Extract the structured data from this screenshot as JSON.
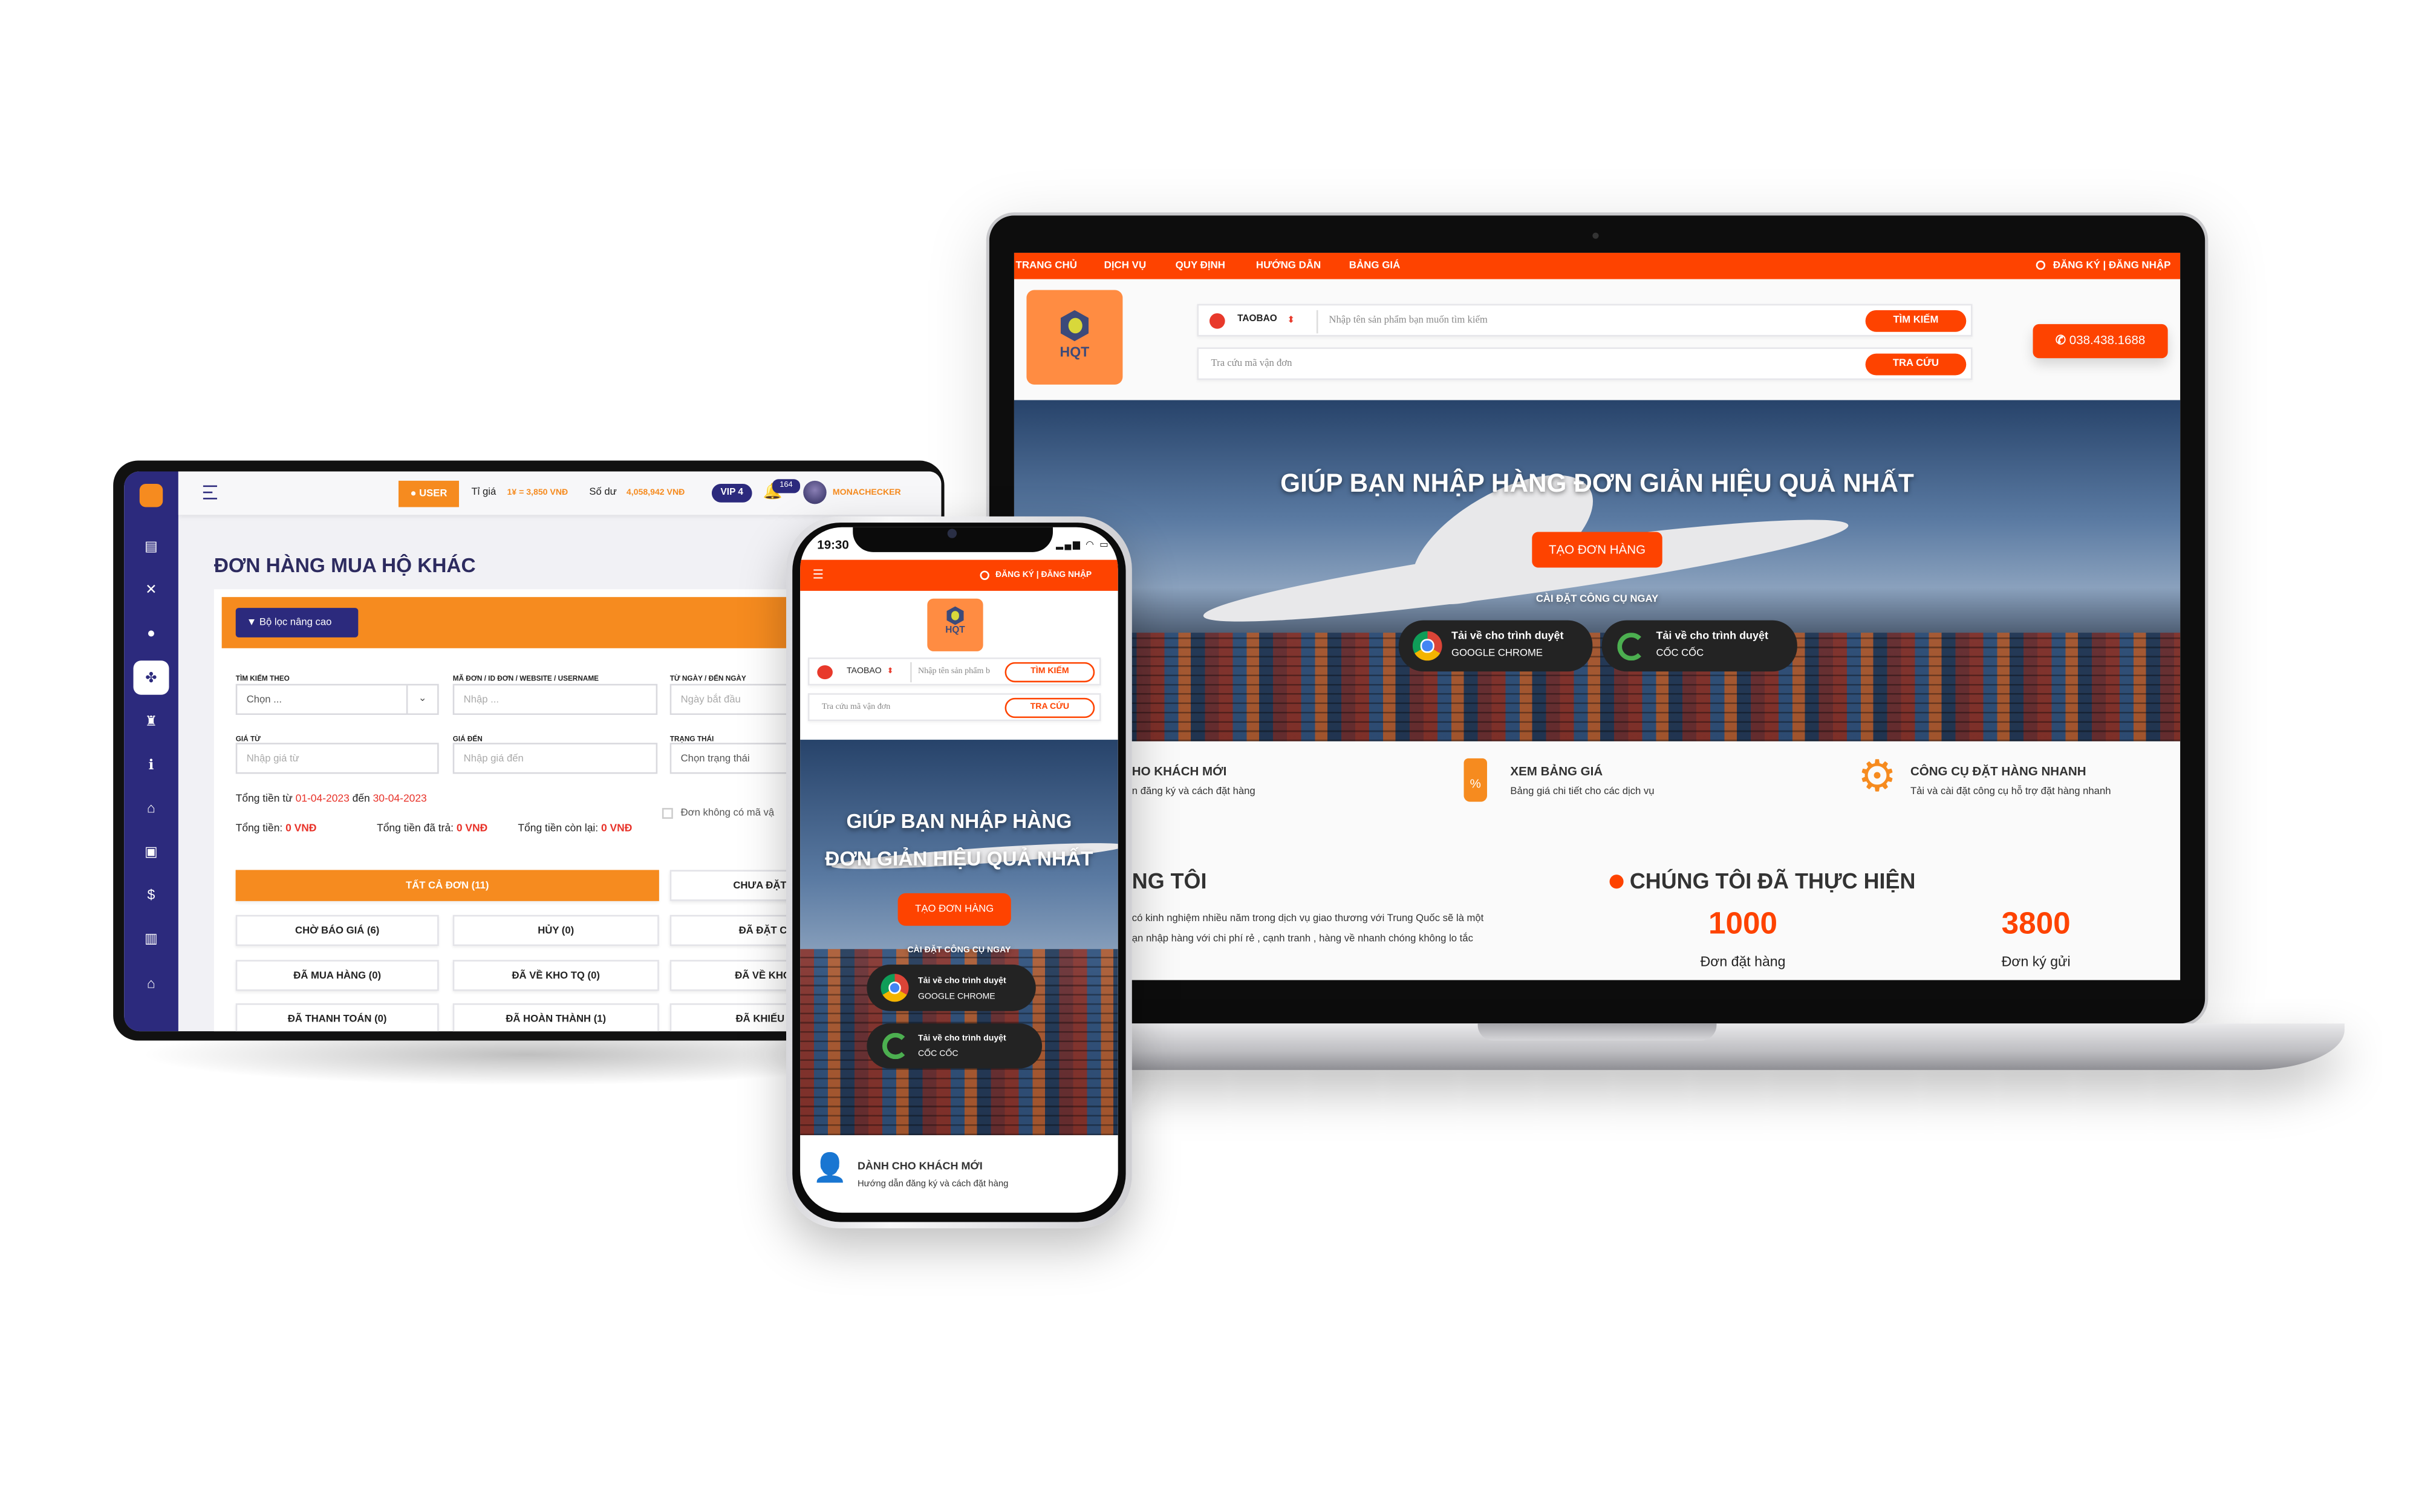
{
  "colors": {
    "brand_orange": "#fe4300",
    "admin_orange": "#f68b1f",
    "admin_navy": "#2c2a7d",
    "logo_orange": "#ff8c42",
    "value_red": "#e8332a"
  },
  "laptop": {
    "nav": [
      "TRANG CHỦ",
      "DỊCH VỤ",
      "QUY ĐỊNH",
      "HƯỚNG DẪN",
      "BẢNG GIÁ"
    ],
    "auth": "ĐĂNG KÝ | ĐĂNG NHẬP",
    "logo": "HQT",
    "search": {
      "platform": "TAOBAO",
      "placeholder": "Nhập tên sản phẩm bạn muốn tìm kiếm",
      "button": "TÌM KIẾM"
    },
    "tracking": {
      "placeholder": "Tra cứu mã vận đơn",
      "button": "TRA CỨU"
    },
    "hotline": "038.438.1688",
    "hero": {
      "title": "GIÚP BẠN NHẬP HÀNG ĐƠN GIẢN HIỆU QUẢ NHẤT",
      "cta": "TẠO ĐƠN HÀNG",
      "tools_label": "CÀI ĐẶT CÔNG CỤ NGAY",
      "tools": [
        {
          "line1": "Tải về cho trình duyệt",
          "line2": "GOOGLE CHROME",
          "icon": "chrome-icon"
        },
        {
          "line1": "Tải về cho trình duyệt",
          "line2": "CỐC CỐC",
          "icon": "coccoc-icon"
        }
      ]
    },
    "features": [
      {
        "title": "HO KHÁCH MỚI",
        "desc": "n đăng ký và cách đặt hàng"
      },
      {
        "title": "XEM BẢNG GIÁ",
        "desc": "Bảng giá chi tiết cho các dịch vụ",
        "icon": "price-tag-icon"
      },
      {
        "title": "CÔNG CỤ ĐẶT HÀNG NHANH",
        "desc": "Tải và cài đặt công cụ hỗ trợ đặt hàng nhanh",
        "icon": "gear-icon"
      }
    ],
    "about_title": "NG TÔI",
    "about_text": [
      "có kinh nghiệm nhiều năm trong dịch vụ giao thương với Trung Quốc sẽ là một",
      "ạn nhập hàng với chi phí rẻ , cạnh tranh , hàng về nhanh chóng không lo tắc"
    ],
    "stats_title": "CHÚNG TÔI ĐÃ THỰC HIỆN",
    "stats": [
      {
        "value": "1000",
        "label": "Đơn đặt hàng"
      },
      {
        "value": "3800",
        "label": "Đơn ký gửi"
      }
    ]
  },
  "tablet": {
    "topbar": {
      "user_label": "USER",
      "rate_label": "Tỉ giá",
      "rate_value": "1¥ = 3,850 VNĐ",
      "balance_label": "Số dư",
      "balance_value": "4,058,942 VNĐ",
      "vip": "VIP 4",
      "notif_count": "164",
      "username": "MONACHECKER"
    },
    "sidebar": [
      "logo-icon",
      "list-icon",
      "tools-icon",
      "users-icon",
      "boxes-icon",
      "person-cart-icon",
      "info-icon",
      "warehouse-icon",
      "package-icon",
      "money-hand-icon",
      "chart-icon",
      "home-icon"
    ],
    "title": "ĐƠN HÀNG MUA HỘ KHÁC",
    "filter_button": "Bộ lọc nâng cao",
    "fields": [
      {
        "label": "TÌM KIẾM THEO",
        "placeholder": "Chọn ..."
      },
      {
        "label": "MÃ ĐƠN / ID ĐƠN / WEBSITE / USERNAME",
        "placeholder": "Nhập ..."
      },
      {
        "label": "TỪ NGÀY / ĐẾN NGÀY",
        "placeholder": "Ngày bắt đầu"
      },
      {
        "label": "GIÁ TỪ",
        "placeholder": "Nhập giá từ"
      },
      {
        "label": "GIÁ ĐẾN",
        "placeholder": "Nhập giá đến"
      },
      {
        "label": "TRẠNG THÁI",
        "placeholder": "Chọn trạng thái"
      }
    ],
    "range": {
      "prefix": "Tổng tiền từ",
      "from": "01-04-2023",
      "mid": "đến",
      "to": "30-04-2023"
    },
    "totals": [
      {
        "label": "Tổng tiền:",
        "value": "0 VNĐ"
      },
      {
        "label": "Tổng tiền đã trả:",
        "value": "0 VNĐ"
      },
      {
        "label": "Tổng tiền còn lại:",
        "value": "0 VNĐ"
      }
    ],
    "checkbox_label": "Đơn không có mã vậ",
    "status_all": "TẤT CẢ ĐƠN  (11)",
    "status_buttons": [
      "CHƯA ĐẶT (",
      "CHỜ BÁO GIÁ  (6)",
      "HỦY  (0)",
      "ĐÃ ĐẶT C",
      "ĐÃ MUA HÀNG  (0)",
      "ĐÃ VỀ KHO TQ  (0)",
      "ĐÃ VỀ KHO",
      "ĐÃ THANH TOÁN  (0)",
      "ĐÃ HOÀN THÀNH  (1)",
      "ĐÃ KHIẾU I"
    ]
  },
  "phone": {
    "time": "19:30",
    "auth": "ĐĂNG KÝ | ĐĂNG NHẬP",
    "logo": "HQT",
    "search": {
      "platform": "TAOBAO",
      "placeholder": "Nhập tên sản phẩm b",
      "button": "TÌM KIẾM"
    },
    "tracking": {
      "placeholder": "Tra cứu mã vận đơn",
      "button": "TRA CỨU"
    },
    "hero": {
      "title_lines": [
        "GIÚP BẠN NHẬP HÀNG",
        "ĐƠN GIẢN HIỆU QUẢ NHẤT"
      ],
      "cta": "TẠO ĐƠN HÀNG",
      "tools_label": "CÀI ĐẶT CÔNG CỤ NGAY",
      "tools": [
        {
          "line1": "Tải về cho trình duyệt",
          "line2": "GOOGLE CHROME"
        },
        {
          "line1": "Tải về cho trình duyệt",
          "line2": "CỐC CỐC"
        }
      ]
    },
    "feature": {
      "title": "DÀNH CHO KHÁCH MỚI",
      "desc": "Hướng dẫn đăng ký và cách đặt hàng"
    }
  }
}
